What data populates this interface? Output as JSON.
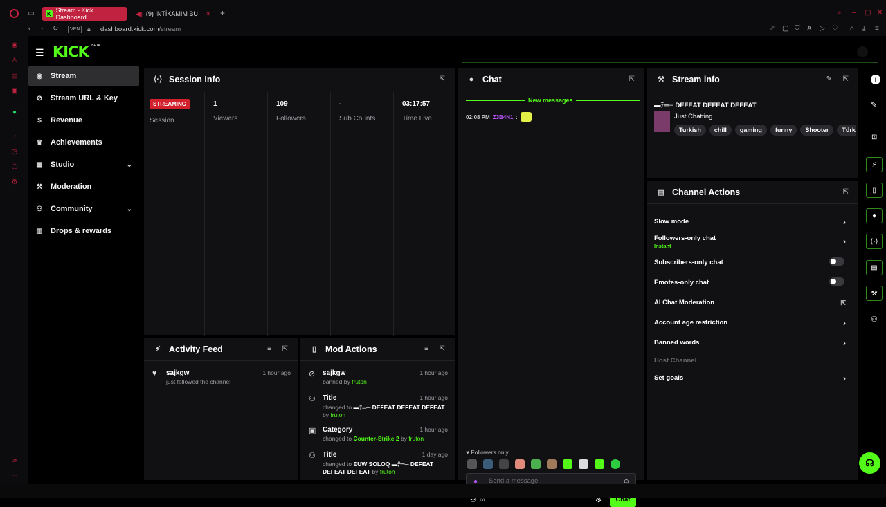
{
  "browser": {
    "tabs": [
      {
        "label": "Stream - Kick Dashboard",
        "active": true
      },
      {
        "label": "(9) İNTİKAMIM BU",
        "active": false
      }
    ],
    "new_tab": "+",
    "vpn_label": "VPN",
    "url_host": "dashboard.kick.com",
    "url_path": "/stream"
  },
  "logo": {
    "text": "KICK",
    "beta": "BETA"
  },
  "sidebar": {
    "items": [
      {
        "label": "Stream",
        "icon": "broadcast-icon"
      },
      {
        "label": "Stream URL & Key",
        "icon": "link-icon"
      },
      {
        "label": "Revenue",
        "icon": "dollar-icon"
      },
      {
        "label": "Achievements",
        "icon": "trophy-icon"
      },
      {
        "label": "Studio",
        "icon": "studio-icon"
      },
      {
        "label": "Moderation",
        "icon": "wrench-icon"
      },
      {
        "label": "Community",
        "icon": "users-icon"
      },
      {
        "label": "Drops & rewards",
        "icon": "gift-icon"
      }
    ]
  },
  "session": {
    "title": "Session Info",
    "status_badge": "STREAMING",
    "status_label": "Session",
    "stats": [
      {
        "value": "1",
        "label": "Viewers"
      },
      {
        "value": "109",
        "label": "Followers"
      },
      {
        "value": "-",
        "label": "Sub Counts"
      },
      {
        "value": "03:17:57",
        "label": "Time Live"
      }
    ]
  },
  "chat": {
    "title": "Chat",
    "new_messages": "New messages",
    "messages": [
      {
        "time": "02:08 PM",
        "user": "Z3B4N1",
        "sep": ":"
      }
    ],
    "followers_only": "Followers only",
    "placeholder": "Send a message",
    "send_label": "Chat"
  },
  "stream_info": {
    "title": "Stream info",
    "stream_title": "▬ﾃ═─ DEFEAT DEFEAT DEFEAT",
    "category": "Just Chatting",
    "tags": [
      "Turkish",
      "chill",
      "gaming",
      "funny",
      "Shooter",
      "Türkçe"
    ]
  },
  "channel_actions": {
    "title": "Channel Actions",
    "rows": [
      {
        "label": "Slow mode",
        "control": "chevron"
      },
      {
        "label": "Followers-only chat",
        "sub": "Instant",
        "control": "chevron"
      },
      {
        "label": "Subscribers-only chat",
        "control": "toggle"
      },
      {
        "label": "Emotes-only chat",
        "control": "toggle"
      },
      {
        "label": "AI Chat Moderation",
        "control": "external"
      },
      {
        "label": "Account age restriction",
        "control": "chevron"
      },
      {
        "label": "Banned words",
        "control": "chevron"
      },
      {
        "label": "Host Channel",
        "control": "none"
      },
      {
        "label": "Set goals",
        "control": "chevron"
      }
    ]
  },
  "activity_feed": {
    "title": "Activity Feed",
    "items": [
      {
        "title": "sajkgw",
        "sub": "just followed the channel",
        "time": "1 hour ago"
      }
    ]
  },
  "mod_actions": {
    "title": "Mod Actions",
    "items": [
      {
        "title": "sajkgw",
        "sub_prefix": "banned by",
        "by": "fruton",
        "time": "1 hour ago"
      },
      {
        "title": "Title",
        "sub_prefix": "changed to",
        "value": "▬ﾃ═─ DEFEAT DEFEAT DEFEAT",
        "sub_by": "by",
        "by": "fruton",
        "time": "1 hour ago"
      },
      {
        "title": "Category",
        "sub_prefix": "changed to",
        "value": "Counter-Strike 2",
        "sub_by": "by",
        "by": "fruton",
        "time": "1 hour ago"
      },
      {
        "title": "Title",
        "sub_prefix": "changed to",
        "value": "EUW SOLOQ ▬ﾃ═─ DEFEAT DEFEAT DEFEAT",
        "sub_by": "by",
        "by": "fruton",
        "time": "1 day ago"
      }
    ]
  },
  "colors": {
    "accent": "#53fc18",
    "streaming": "#d2212d",
    "opera": "#c0223f"
  }
}
